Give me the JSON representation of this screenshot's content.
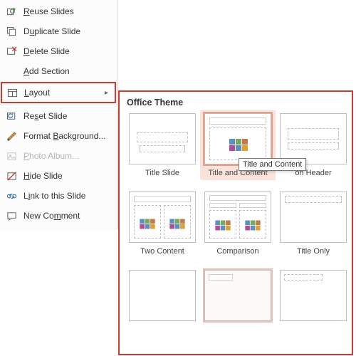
{
  "menu": {
    "reuse": "Reuse Slides",
    "duplicate": "Duplicate Slide",
    "delete": "Delete Slide",
    "add_section": "Add Section",
    "layout": "Layout",
    "reset": "Reset Slide",
    "format_bg": "Format Background...",
    "photo_album": "Photo Album...",
    "hide": "Hide Slide",
    "link": "Link to this Slide",
    "new_comment": "New Comment"
  },
  "layout_panel": {
    "theme": "Office Theme",
    "tooltip": "Title and Content",
    "items": [
      "Title Slide",
      "Title and Content",
      "Section Header",
      "Two Content",
      "Comparison",
      "Title Only"
    ]
  }
}
